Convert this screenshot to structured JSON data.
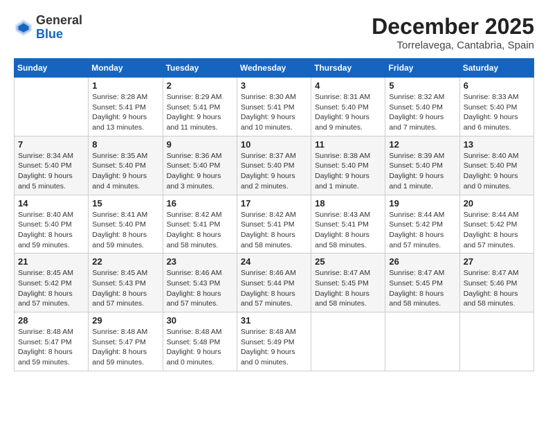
{
  "header": {
    "logo_general": "General",
    "logo_blue": "Blue",
    "month_title": "December 2025",
    "location": "Torrelavega, Cantabria, Spain"
  },
  "days_of_week": [
    "Sunday",
    "Monday",
    "Tuesday",
    "Wednesday",
    "Thursday",
    "Friday",
    "Saturday"
  ],
  "weeks": [
    [
      {
        "day": "",
        "info": ""
      },
      {
        "day": "1",
        "info": "Sunrise: 8:28 AM\nSunset: 5:41 PM\nDaylight: 9 hours\nand 13 minutes."
      },
      {
        "day": "2",
        "info": "Sunrise: 8:29 AM\nSunset: 5:41 PM\nDaylight: 9 hours\nand 11 minutes."
      },
      {
        "day": "3",
        "info": "Sunrise: 8:30 AM\nSunset: 5:41 PM\nDaylight: 9 hours\nand 10 minutes."
      },
      {
        "day": "4",
        "info": "Sunrise: 8:31 AM\nSunset: 5:40 PM\nDaylight: 9 hours\nand 9 minutes."
      },
      {
        "day": "5",
        "info": "Sunrise: 8:32 AM\nSunset: 5:40 PM\nDaylight: 9 hours\nand 7 minutes."
      },
      {
        "day": "6",
        "info": "Sunrise: 8:33 AM\nSunset: 5:40 PM\nDaylight: 9 hours\nand 6 minutes."
      }
    ],
    [
      {
        "day": "7",
        "info": "Sunrise: 8:34 AM\nSunset: 5:40 PM\nDaylight: 9 hours\nand 5 minutes."
      },
      {
        "day": "8",
        "info": "Sunrise: 8:35 AM\nSunset: 5:40 PM\nDaylight: 9 hours\nand 4 minutes."
      },
      {
        "day": "9",
        "info": "Sunrise: 8:36 AM\nSunset: 5:40 PM\nDaylight: 9 hours\nand 3 minutes."
      },
      {
        "day": "10",
        "info": "Sunrise: 8:37 AM\nSunset: 5:40 PM\nDaylight: 9 hours\nand 2 minutes."
      },
      {
        "day": "11",
        "info": "Sunrise: 8:38 AM\nSunset: 5:40 PM\nDaylight: 9 hours\nand 1 minute."
      },
      {
        "day": "12",
        "info": "Sunrise: 8:39 AM\nSunset: 5:40 PM\nDaylight: 9 hours\nand 1 minute."
      },
      {
        "day": "13",
        "info": "Sunrise: 8:40 AM\nSunset: 5:40 PM\nDaylight: 9 hours\nand 0 minutes."
      }
    ],
    [
      {
        "day": "14",
        "info": "Sunrise: 8:40 AM\nSunset: 5:40 PM\nDaylight: 8 hours\nand 59 minutes."
      },
      {
        "day": "15",
        "info": "Sunrise: 8:41 AM\nSunset: 5:40 PM\nDaylight: 8 hours\nand 59 minutes."
      },
      {
        "day": "16",
        "info": "Sunrise: 8:42 AM\nSunset: 5:41 PM\nDaylight: 8 hours\nand 58 minutes."
      },
      {
        "day": "17",
        "info": "Sunrise: 8:42 AM\nSunset: 5:41 PM\nDaylight: 8 hours\nand 58 minutes."
      },
      {
        "day": "18",
        "info": "Sunrise: 8:43 AM\nSunset: 5:41 PM\nDaylight: 8 hours\nand 58 minutes."
      },
      {
        "day": "19",
        "info": "Sunrise: 8:44 AM\nSunset: 5:42 PM\nDaylight: 8 hours\nand 57 minutes."
      },
      {
        "day": "20",
        "info": "Sunrise: 8:44 AM\nSunset: 5:42 PM\nDaylight: 8 hours\nand 57 minutes."
      }
    ],
    [
      {
        "day": "21",
        "info": "Sunrise: 8:45 AM\nSunset: 5:42 PM\nDaylight: 8 hours\nand 57 minutes."
      },
      {
        "day": "22",
        "info": "Sunrise: 8:45 AM\nSunset: 5:43 PM\nDaylight: 8 hours\nand 57 minutes."
      },
      {
        "day": "23",
        "info": "Sunrise: 8:46 AM\nSunset: 5:43 PM\nDaylight: 8 hours\nand 57 minutes."
      },
      {
        "day": "24",
        "info": "Sunrise: 8:46 AM\nSunset: 5:44 PM\nDaylight: 8 hours\nand 57 minutes."
      },
      {
        "day": "25",
        "info": "Sunrise: 8:47 AM\nSunset: 5:45 PM\nDaylight: 8 hours\nand 58 minutes."
      },
      {
        "day": "26",
        "info": "Sunrise: 8:47 AM\nSunset: 5:45 PM\nDaylight: 8 hours\nand 58 minutes."
      },
      {
        "day": "27",
        "info": "Sunrise: 8:47 AM\nSunset: 5:46 PM\nDaylight: 8 hours\nand 58 minutes."
      }
    ],
    [
      {
        "day": "28",
        "info": "Sunrise: 8:48 AM\nSunset: 5:47 PM\nDaylight: 8 hours\nand 59 minutes."
      },
      {
        "day": "29",
        "info": "Sunrise: 8:48 AM\nSunset: 5:47 PM\nDaylight: 8 hours\nand 59 minutes."
      },
      {
        "day": "30",
        "info": "Sunrise: 8:48 AM\nSunset: 5:48 PM\nDaylight: 9 hours\nand 0 minutes."
      },
      {
        "day": "31",
        "info": "Sunrise: 8:48 AM\nSunset: 5:49 PM\nDaylight: 9 hours\nand 0 minutes."
      },
      {
        "day": "",
        "info": ""
      },
      {
        "day": "",
        "info": ""
      },
      {
        "day": "",
        "info": ""
      }
    ]
  ]
}
